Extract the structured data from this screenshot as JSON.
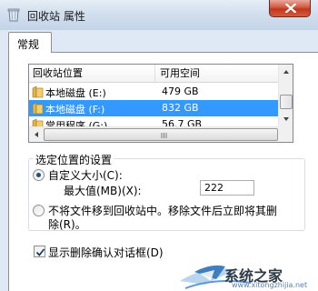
{
  "window": {
    "title": "回收站 属性",
    "close_icon": "close-icon",
    "title_icon": "recycle-bin-icon"
  },
  "tabs": [
    {
      "label": "常规",
      "active": true
    }
  ],
  "location_list": {
    "columns": [
      "回收站位置",
      "可用空间"
    ],
    "rows": [
      {
        "name": "本地磁盘 (E:)",
        "space": "479 GB",
        "selected": false
      },
      {
        "name": "本地磁盘 (F:)",
        "space": "832 GB",
        "selected": true
      },
      {
        "name": "常用程序 (G:)",
        "space": "56.7 GB",
        "selected": false
      }
    ],
    "icon": "drive-icon"
  },
  "settings": {
    "group_title": "选定位置的设置",
    "custom_size_label": "自定义大小(C):",
    "max_size_label": "最大值(MB)(X):",
    "max_size_value": "222",
    "custom_size_selected": true,
    "no_recycle_label_line1": "不将文件移到回收站中。移除文件后立即将其删",
    "no_recycle_label_line2": "除(R)。",
    "no_recycle_selected": false
  },
  "confirm_checkbox": {
    "label": "显示删除确认对话框(D)",
    "checked": true
  },
  "watermark": {
    "text": "系统之家",
    "url": "www.xitongzhijia.net"
  },
  "colors": {
    "selection": "#3399ff",
    "glass": "#c3d4e8",
    "close": "#c2371c"
  }
}
